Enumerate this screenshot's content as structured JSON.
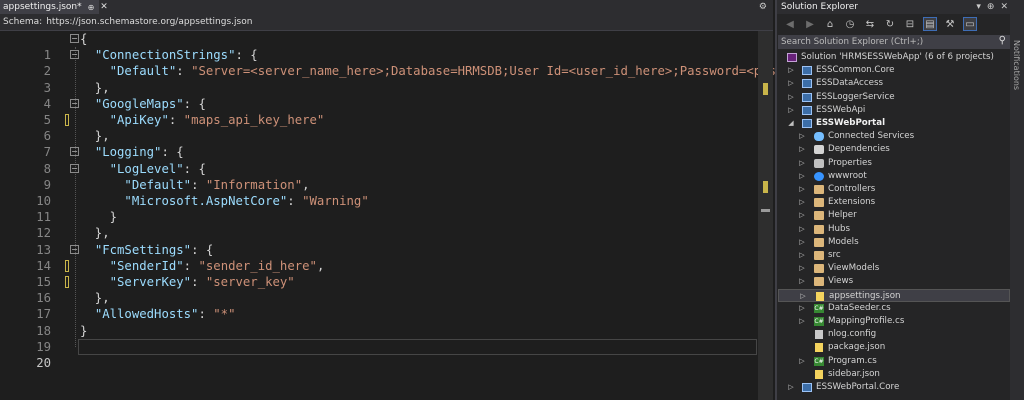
{
  "editor": {
    "tab": {
      "label": "appsettings.json*",
      "pin_icon": "pin-icon",
      "close_icon": "close-icon"
    },
    "schema": {
      "label": "Schema:",
      "url": "https://json.schemastore.org/appsettings.json"
    },
    "current_line": "20",
    "lines": [
      {
        "n": "1"
      },
      {
        "n": "2"
      },
      {
        "n": "3"
      },
      {
        "n": "4"
      },
      {
        "n": "5"
      },
      {
        "n": "6"
      },
      {
        "n": "7"
      },
      {
        "n": "8"
      },
      {
        "n": "9"
      },
      {
        "n": "10"
      },
      {
        "n": "11"
      },
      {
        "n": "12"
      },
      {
        "n": "13"
      },
      {
        "n": "14"
      },
      {
        "n": "15"
      },
      {
        "n": "16"
      },
      {
        "n": "17"
      },
      {
        "n": "18"
      },
      {
        "n": "19"
      },
      {
        "n": "20"
      }
    ],
    "code": {
      "conn_key": "\"ConnectionStrings\"",
      "default_key": "\"Default\"",
      "conn_val": "\"Server=<server_name_here>;Database=HRMSDB;User Id=<user_id_here>;Password=<passw",
      "gmaps_key": "\"GoogleMaps\"",
      "apikey_key": "\"ApiKey\"",
      "apikey_val": "\"maps_api_key_here\"",
      "logging_key": "\"Logging\"",
      "loglevel_key": "\"LogLevel\"",
      "log_default_key": "\"Default\"",
      "log_default_val": "\"Information\"",
      "ms_key": "\"Microsoft.AspNetCore\"",
      "ms_val": "\"Warning\"",
      "fcm_key": "\"FcmSettings\"",
      "sender_key": "\"SenderId\"",
      "sender_val": "\"sender_id_here\"",
      "server_key": "\"ServerKey\"",
      "server_val": "\"server_key\"",
      "hosts_key": "\"AllowedHosts\"",
      "hosts_val": "\"*\""
    }
  },
  "solution_explorer": {
    "title": "Solution Explorer",
    "search_placeholder": "Search Solution Explorer (Ctrl+;)",
    "solution_label": "Solution 'HRMSESSWebApp' (6 of 6 projects)",
    "items": [
      {
        "label": "ESSCommon.Core"
      },
      {
        "label": "ESSDataAccess"
      },
      {
        "label": "ESSLoggerService"
      },
      {
        "label": "ESSWebApi"
      },
      {
        "label": "ESSWebPortal"
      },
      {
        "label": "Connected Services"
      },
      {
        "label": "Dependencies"
      },
      {
        "label": "Properties"
      },
      {
        "label": "wwwroot"
      },
      {
        "label": "Controllers"
      },
      {
        "label": "Extensions"
      },
      {
        "label": "Helper"
      },
      {
        "label": "Hubs"
      },
      {
        "label": "Models"
      },
      {
        "label": "src"
      },
      {
        "label": "ViewModels"
      },
      {
        "label": "Views"
      },
      {
        "label": "appsettings.json"
      },
      {
        "label": "DataSeeder.cs"
      },
      {
        "label": "MappingProfile.cs"
      },
      {
        "label": "nlog.config"
      },
      {
        "label": "package.json"
      },
      {
        "label": "Program.cs"
      },
      {
        "label": "sidebar.json"
      },
      {
        "label": "ESSWebPortal.Core"
      }
    ]
  },
  "side_panel": {
    "label": "Notifications"
  },
  "colors": {
    "key": "#9cdcfe",
    "string": "#ce9178",
    "punct": "#d4d4d4",
    "change_marker": "#c9b54a",
    "selection": "#3f3f46"
  }
}
